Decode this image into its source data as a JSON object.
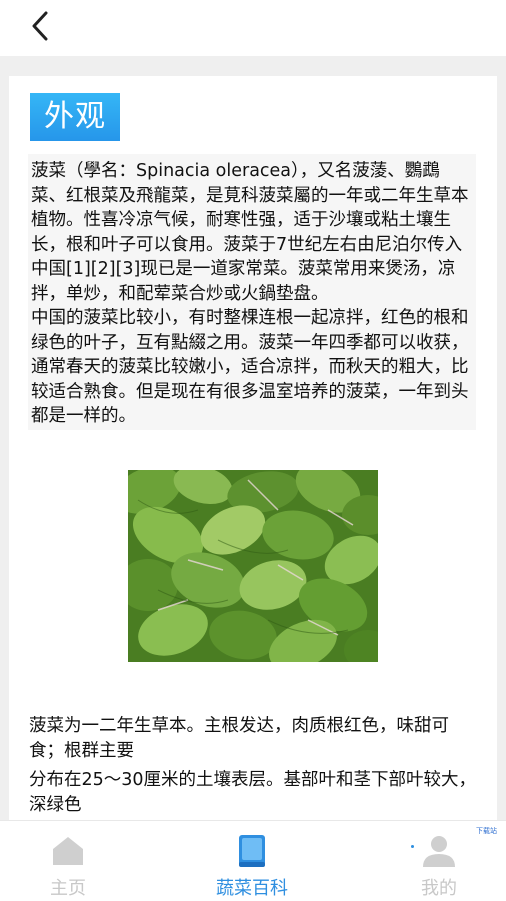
{
  "header": {
    "back_icon": "chevron-left-icon"
  },
  "article": {
    "section_title": "外观",
    "intro": "菠菜（學名：Spinacia oleracea），又名菠蔆、鸚鵡菜、红根菜及飛龍菜，是莧科菠菜屬的一年或二年生草本植物。性喜冷凉气候，耐寒性强，适于沙壤或粘土壤生长，根和叶子可以食用。菠菜于7世纪左右由尼泊尔传入中国[1][2][3]现已是一道家常菜。菠菜常用来煲汤，凉拌，单炒，和配荤菜合炒或火鍋垫盘。\n中国的菠菜比较小，有时整棵连根一起凉拌，红色的根和绿色的叶子，互有點綴之用。菠菜一年四季都可以收获，通常春天的菠菜比较嫩小，适合凉拌，而秋天的粗大，比较适合熟食。但是现在有很多温室培养的菠菜，一年到头都是一样的。",
    "image_subject": "spinach-leaves-photo",
    "desc_1": "菠菜为一二年生草本。主根发达，肉质根红色，味甜可食；根群主要",
    "desc_2": "分布在25～30厘米的土壤表层。基部叶和茎下部叶较大，深绿色"
  },
  "tabbar": {
    "tabs": [
      {
        "label": "主页",
        "icon": "home-icon",
        "active": false
      },
      {
        "label": "蔬菜百科",
        "icon": "book-icon",
        "active": true
      },
      {
        "label": "我的",
        "icon": "user-icon",
        "active": false
      }
    ],
    "watermark": "下载站"
  },
  "colors": {
    "accent": "#2f8fe0",
    "title_bg": "#2e9ff0",
    "inactive_tab": "#c8c8c8",
    "page_bg": "#efefef"
  }
}
